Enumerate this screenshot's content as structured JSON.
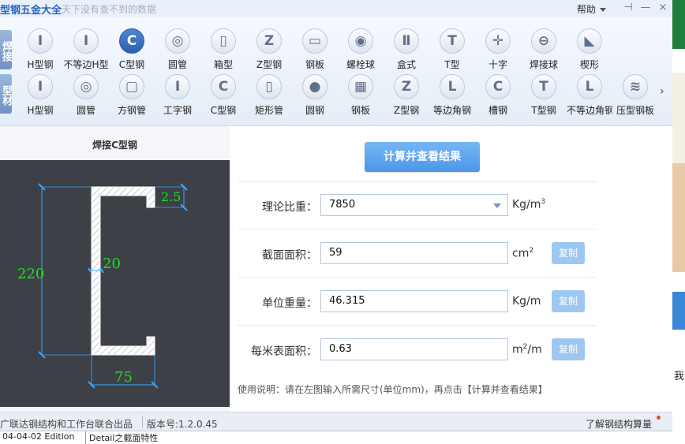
{
  "app": {
    "title": "型钢五金大全",
    "subtitle": "天下没有查不到的数据",
    "help_label": "帮助"
  },
  "toolbar": {
    "categories": [
      {
        "label": "焊接"
      },
      {
        "label": "型材"
      }
    ],
    "weld_row": [
      {
        "label": "H型钢",
        "icon": "I"
      },
      {
        "label": "不等边H型",
        "icon": "I"
      },
      {
        "label": "C型钢",
        "icon": "C"
      },
      {
        "label": "圆管",
        "icon": "◎"
      },
      {
        "label": "箱型",
        "icon": "▯"
      },
      {
        "label": "Z型钢",
        "icon": "Z"
      },
      {
        "label": "钢板",
        "icon": "▭"
      },
      {
        "label": "螺栓球",
        "icon": "◉"
      },
      {
        "label": "盒式",
        "icon": "Ⅱ"
      },
      {
        "label": "T型",
        "icon": "T"
      },
      {
        "label": "十字",
        "icon": "✛"
      },
      {
        "label": "焊接球",
        "icon": "⊖"
      },
      {
        "label": "楔形",
        "icon": "◣"
      }
    ],
    "profile_row": [
      {
        "label": "H型钢",
        "icon": "I"
      },
      {
        "label": "圆管",
        "icon": "◎"
      },
      {
        "label": "方钢管",
        "icon": "▢"
      },
      {
        "label": "工字钢",
        "icon": "I"
      },
      {
        "label": "C型钢",
        "icon": "C"
      },
      {
        "label": "矩形管",
        "icon": "▯"
      },
      {
        "label": "圆钢",
        "icon": "●"
      },
      {
        "label": "钢板",
        "icon": "▦"
      },
      {
        "label": "Z型钢",
        "icon": "Z"
      },
      {
        "label": "等边角钢",
        "icon": "L"
      },
      {
        "label": "槽钢",
        "icon": "C"
      },
      {
        "label": "T型钢",
        "icon": "T"
      },
      {
        "label": "不等边角钢",
        "icon": "L"
      },
      {
        "label": "压型钢板",
        "icon": "≋"
      }
    ],
    "selected": "C型钢"
  },
  "drawing": {
    "title": "焊接C型钢",
    "dims": {
      "height": "220",
      "lip": "2.5",
      "thickness": "20",
      "flange": "75"
    },
    "colors": {
      "background": "#3d4047",
      "dimension": "#19e51e",
      "arrow": "#39a8ff"
    }
  },
  "form": {
    "calc_button": "计算并查看结果",
    "rows": [
      {
        "label": "理论比重：",
        "value": "7850",
        "unit": "Kg/m",
        "unit_sup": "3"
      },
      {
        "label": "截面面积：",
        "value": "59",
        "unit": "cm",
        "unit_sup": "2",
        "copy": "复制"
      },
      {
        "label": "单位重量：",
        "value": "46.315",
        "unit": "Kg/m",
        "unit_sup": "",
        "copy": "复制"
      },
      {
        "label": "每米表面积：",
        "value": "0.63",
        "unit": "m",
        "unit_sup": "2",
        "unit_tail": "/m",
        "copy": "复制"
      }
    ],
    "usage": "使用说明：请在左图输入所需尺寸(单位mm)，再点击【计算并查看结果】"
  },
  "status": {
    "left": "广联达钢结构和工作台联合出品",
    "version": "版本号:1.2.0.45",
    "link": "了解钢结构算量"
  },
  "strip": {
    "a": "04-04-02 Edition",
    "b": "Detail之截面特性"
  },
  "edge": {
    "text": "我"
  }
}
